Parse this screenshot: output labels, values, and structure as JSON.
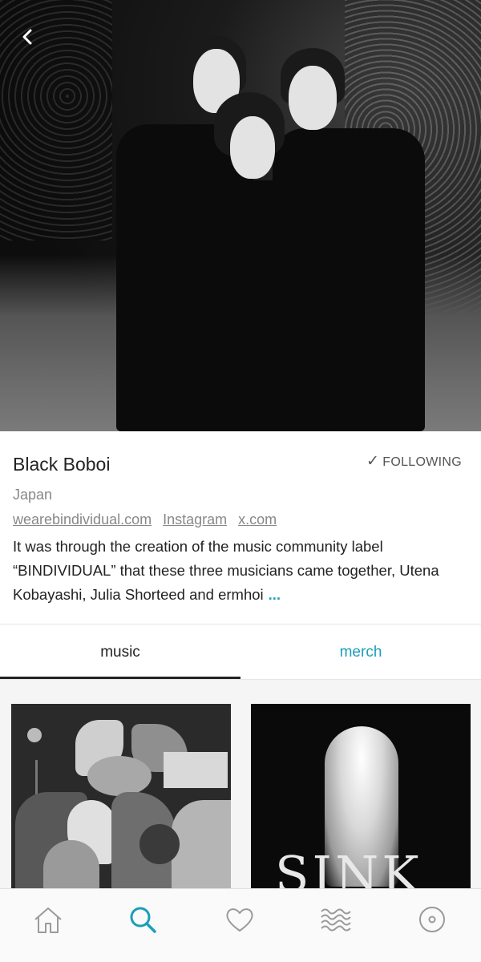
{
  "header": {
    "back_glyph": "‹"
  },
  "artist": {
    "name": "Black Boboi",
    "location": "Japan",
    "follow_label": "FOLLOWING",
    "follow_icon": "checkmark-icon",
    "links": [
      "wearebindividual.com",
      "Instagram",
      "x.com"
    ],
    "bio": "It was through the creation of the music community label “BINDIVIDUAL” that these three musicians came together, Utena Kobayashi, Julia Shorteed and ermhoi",
    "more_label": "..."
  },
  "tabs": [
    {
      "label": "music",
      "active": true
    },
    {
      "label": "merch",
      "active": false
    }
  ],
  "albums": [
    {
      "cover_text": ""
    },
    {
      "cover_text": "SINK"
    }
  ],
  "nav": [
    {
      "icon": "home-icon",
      "active": false
    },
    {
      "icon": "search-icon",
      "active": true
    },
    {
      "icon": "heart-icon",
      "active": false
    },
    {
      "icon": "feed-icon",
      "active": false
    },
    {
      "icon": "record-icon",
      "active": false
    }
  ],
  "colors": {
    "accent": "#1a9fb8",
    "more": "#1da0c3",
    "text": "#222222",
    "muted": "#888888"
  }
}
